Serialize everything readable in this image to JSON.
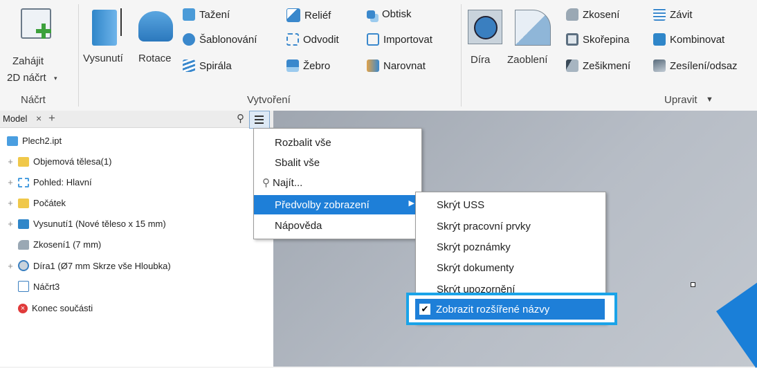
{
  "ribbon": {
    "sketch_group": {
      "title": "Náčrt",
      "start_label_1": "Zahájit",
      "start_label_2": "2D náčrt"
    },
    "create_group": {
      "title": "Vytvoření",
      "extrude": "Vysunutí",
      "revolve": "Rotace",
      "sweep": "Tažení",
      "loft": "Šablonování",
      "coil": "Spirála",
      "emboss": "Reliéf",
      "derive": "Odvodit",
      "rib": "Žebro",
      "decal": "Obtisk",
      "import": "Importovat",
      "unwrap": "Narovnat"
    },
    "modify_group": {
      "title": "Upravit",
      "hole": "Díra",
      "fillet": "Zaoblení",
      "chamfer": "Zkosení",
      "shell": "Skořepina",
      "draft": "Zešikmení",
      "thread": "Závit",
      "combine": "Kombinovat",
      "thicken": "Zesílení/odsaz"
    }
  },
  "browser": {
    "tab_label": "Model",
    "tree": [
      "Plech2.ipt",
      "Objemová tělesa(1)",
      "Pohled: Hlavní",
      "Počátek",
      "Vysunutí1 (Nové těleso x 15 mm)",
      "Zkosení1 (7 mm)",
      "Díra1 (Ø7 mm Skrze vše Hloubka)",
      "Náčrt3",
      "Konec součásti"
    ]
  },
  "menu": {
    "expand_all": "Rozbalit vše",
    "collapse_all": "Sbalit vše",
    "find": "Najít...",
    "display_prefs": "Předvolby zobrazení",
    "help": "Nápověda"
  },
  "submenu": {
    "hide_ucs": "Skrýt USS",
    "hide_work": "Skrýt pracovní prvky",
    "hide_notes": "Skrýt poznámky",
    "hide_docs": "Skrýt dokumenty",
    "hide_alerts": "Skrýt upozornění",
    "show_extended": "Zobrazit rozšířené názvy"
  },
  "colors": {
    "accent": "#1e7fd8",
    "highlight_box": "#1aa3e8"
  }
}
